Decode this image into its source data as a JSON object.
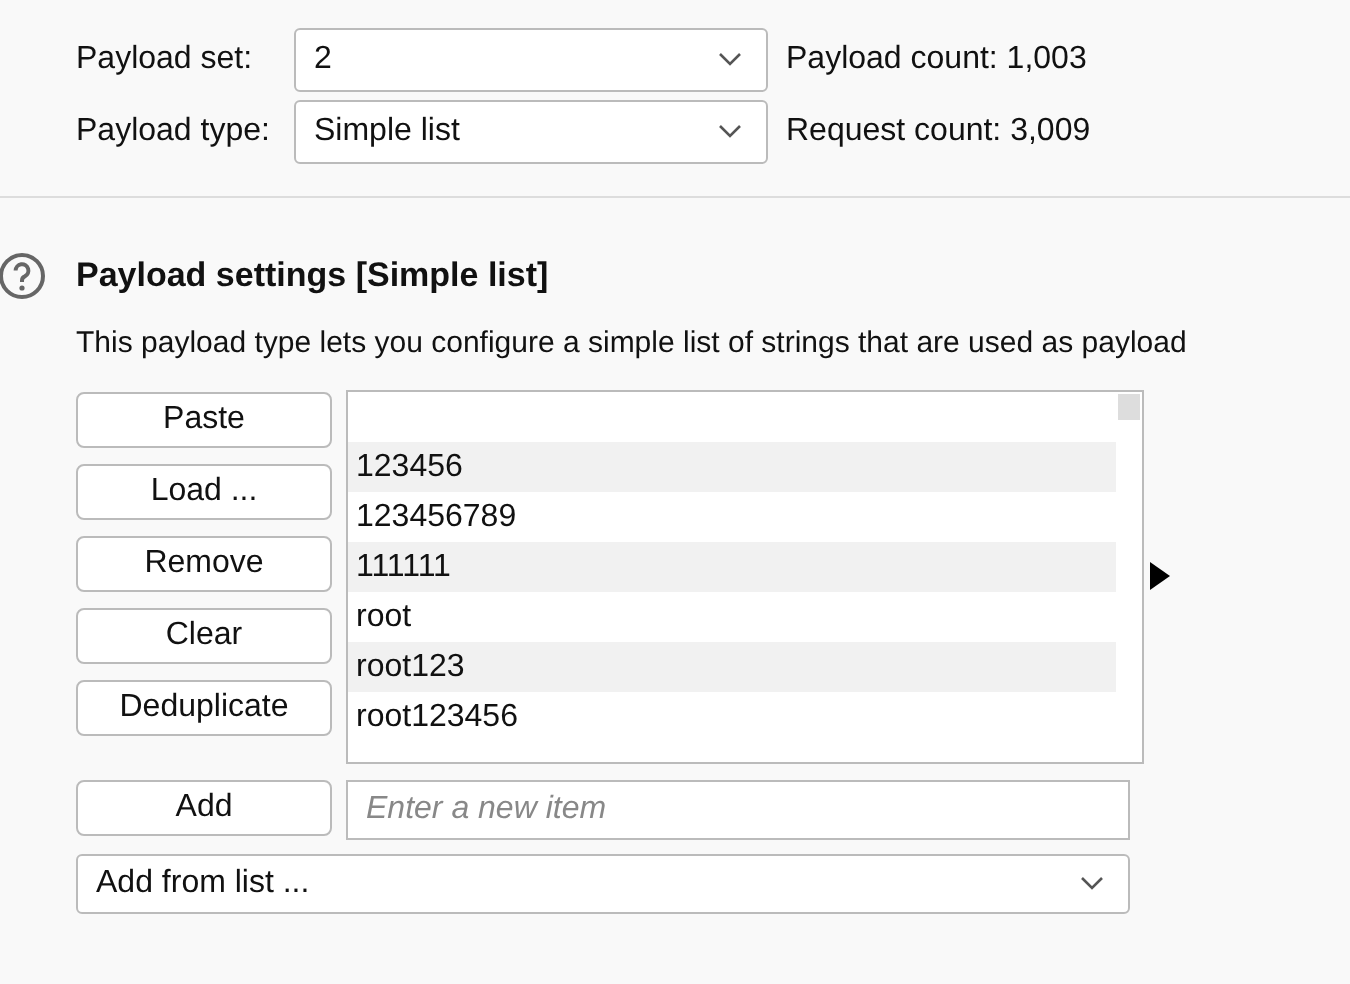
{
  "payload_set": {
    "label": "Payload set:",
    "value": "2"
  },
  "payload_type": {
    "label": "Payload type:",
    "value": "Simple list"
  },
  "payload_count": {
    "label": "Payload count:",
    "value": "1,003"
  },
  "request_count": {
    "label": "Request count:",
    "value": "3,009"
  },
  "settings": {
    "title": "Payload settings [Simple list]",
    "description": "This payload type lets you configure a simple list of strings that are used as payload"
  },
  "buttons": [
    "Paste",
    "Load ...",
    "Remove",
    "Clear",
    "Deduplicate"
  ],
  "items": [
    "123456",
    "123456789",
    "111111",
    "root",
    "root123",
    "root123456"
  ],
  "add_button": "Add",
  "new_item": {
    "placeholder": "Enter a new item"
  },
  "add_from_list": {
    "value": "Add from list ..."
  }
}
